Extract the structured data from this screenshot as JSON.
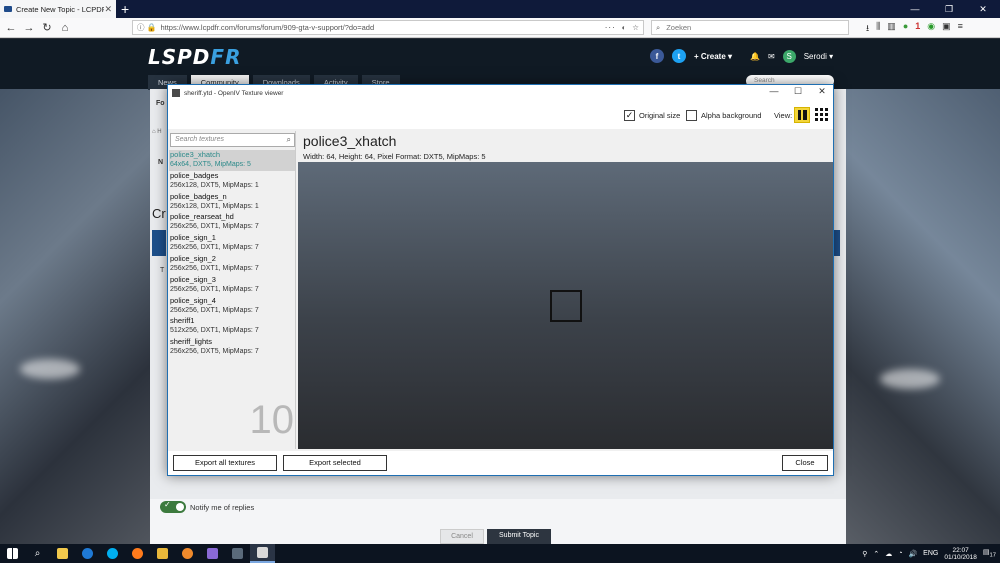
{
  "browser": {
    "tab_title": "Create New Topic - LCPDFR.co",
    "url": "https://www.lcpdfr.com/forums/forum/909-gta-v-support/?do=add",
    "url_tail": "···",
    "search_placeholder": "Zoeken",
    "toolbar_badge": "1"
  },
  "site": {
    "logo_main": "LSPD",
    "logo_accent": "FR",
    "create_label": "+ Create ▾",
    "user_initial": "S",
    "username": "Serodi ▾",
    "nav": [
      "News",
      "Community",
      "Downloads",
      "Activity",
      "Store"
    ],
    "nav_active": 1,
    "search_placeholder": "Search",
    "page_heading_fragment": "Cr",
    "sidebar_fragment": "N",
    "label_fragment": "T",
    "breadcrumb_fragment": "Fo",
    "notify_label": "Notify me of replies",
    "cancel_label": "Cancel",
    "submit_label": "Submit Topic"
  },
  "dialog": {
    "title": "sheriff.ytd - OpenIV Texture viewer",
    "original_size_label": "Original size",
    "original_size_checked": true,
    "alpha_background_label": "Alpha background",
    "alpha_background_checked": false,
    "view_label": "View:",
    "search_placeholder": "Search textures",
    "textures": [
      {
        "name": "police3_xhatch",
        "info": "64x64, DXT5, MipMaps: 5",
        "selected": true
      },
      {
        "name": "police_badges",
        "info": "256x128, DXT5, MipMaps: 1"
      },
      {
        "name": "police_badges_n",
        "info": "256x128, DXT1, MipMaps: 1"
      },
      {
        "name": "police_rearseat_hd",
        "info": "256x256, DXT1, MipMaps: 7"
      },
      {
        "name": "police_sign_1",
        "info": "256x256, DXT1, MipMaps: 7"
      },
      {
        "name": "police_sign_2",
        "info": "256x256, DXT1, MipMaps: 7"
      },
      {
        "name": "police_sign_3",
        "info": "256x256, DXT1, MipMaps: 7"
      },
      {
        "name": "police_sign_4",
        "info": "256x256, DXT1, MipMaps: 7"
      },
      {
        "name": "sheriff1",
        "info": "512x256, DXT1, MipMaps: 7"
      },
      {
        "name": "sheriff_lights",
        "info": "256x256, DXT5, MipMaps: 7"
      }
    ],
    "texture_count": "10",
    "selected_title": "police3_xhatch",
    "selected_info": "Width: 64, Height: 64, Pixel Format: DXT5, MipMaps: 5",
    "export_all_label": "Export all textures",
    "export_selected_label": "Export selected",
    "close_label": "Close"
  },
  "taskbar": {
    "language": "ENG",
    "time": "22:07",
    "date": "01/10/2018",
    "notification_count": "17"
  },
  "colors": {
    "selected_text": "#2c8a8a",
    "logo_accent": "#3aa0e0",
    "view_active": "#f3d53a",
    "dialog_border": "#1f6fb2"
  }
}
